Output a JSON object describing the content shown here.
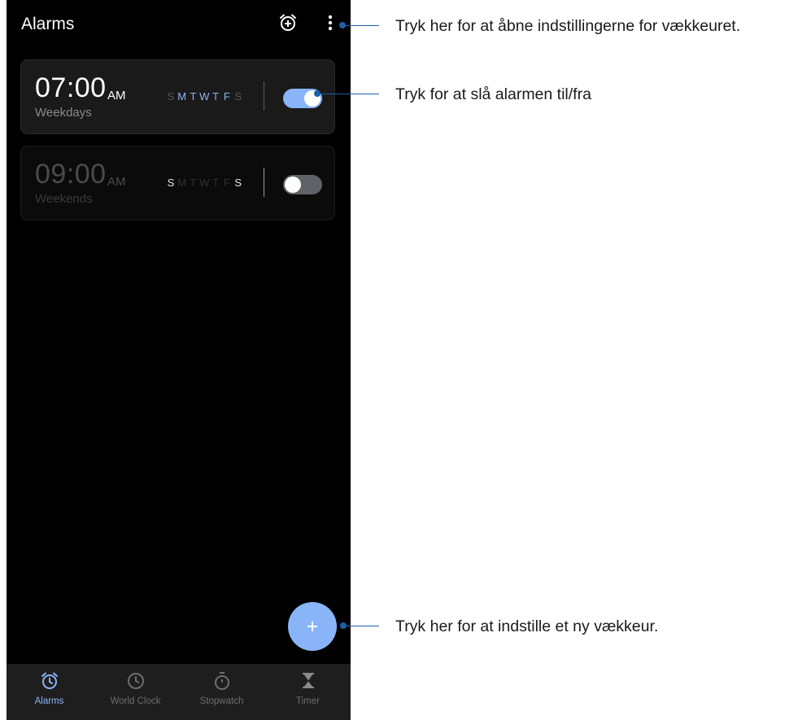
{
  "header": {
    "title": "Alarms",
    "add_icon": "alarm-add-icon",
    "menu_icon": "more-vertical-icon"
  },
  "alarms": [
    {
      "time": "07:00",
      "ampm": "AM",
      "label": "Weekdays",
      "days": [
        "S",
        "M",
        "T",
        "W",
        "T",
        "F",
        "S"
      ],
      "active_days": [
        false,
        true,
        true,
        true,
        true,
        true,
        false
      ],
      "enabled": true
    },
    {
      "time": "09:00",
      "ampm": "AM",
      "label": "Weekends",
      "days": [
        "S",
        "M",
        "T",
        "W",
        "T",
        "F",
        "S"
      ],
      "active_days": [
        true,
        false,
        false,
        false,
        false,
        false,
        true
      ],
      "enabled": false
    }
  ],
  "fab": {
    "icon": "plus-icon"
  },
  "nav": [
    {
      "label": "Alarms",
      "icon": "alarm-clock-icon",
      "active": true
    },
    {
      "label": "World Clock",
      "icon": "clock-icon",
      "active": false
    },
    {
      "label": "Stopwatch",
      "icon": "stopwatch-icon",
      "active": false
    },
    {
      "label": "Timer",
      "icon": "hourglass-icon",
      "active": false
    }
  ],
  "callouts": {
    "settings": "Tryk her for at åbne indstillingerne for vækkeuret.",
    "toggle": "Tryk for at slå alarmen til/fra",
    "new_alarm": "Tryk her for at indstille et ny vækkeur."
  },
  "colors": {
    "accent": "#8ab4f8",
    "background": "#000000",
    "callout": "#1b5fa8"
  }
}
